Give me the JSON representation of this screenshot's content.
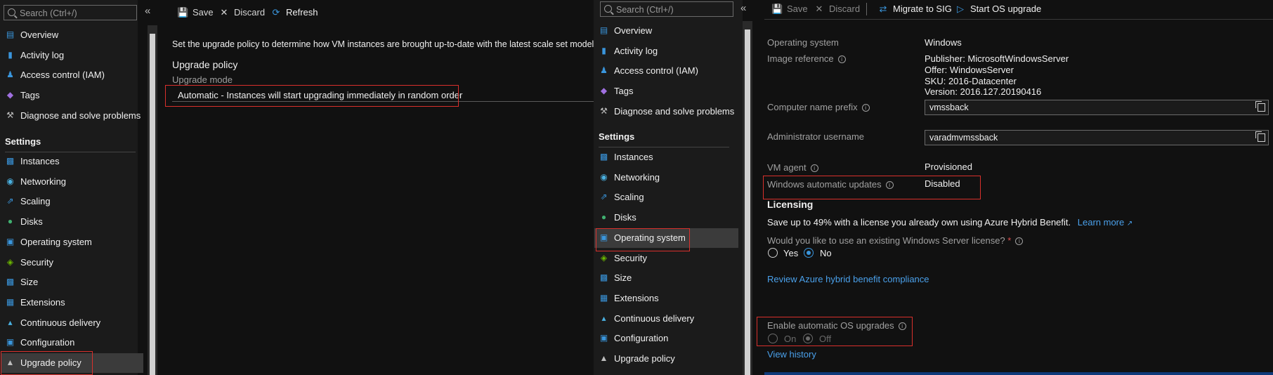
{
  "left_nav": {
    "search_placeholder": "Search (Ctrl+/)",
    "collapse_glyph": "«",
    "items_top": [
      {
        "label": "Overview",
        "icon": "overview-icon"
      },
      {
        "label": "Activity log",
        "icon": "activity-log-icon"
      },
      {
        "label": "Access control (IAM)",
        "icon": "access-control-icon"
      },
      {
        "label": "Tags",
        "icon": "tag-icon"
      },
      {
        "label": "Diagnose and solve problems",
        "icon": "wrench-icon"
      }
    ],
    "settings_header": "Settings",
    "items_settings": [
      {
        "label": "Instances",
        "icon": "instances-icon"
      },
      {
        "label": "Networking",
        "icon": "networking-icon"
      },
      {
        "label": "Scaling",
        "icon": "scaling-icon"
      },
      {
        "label": "Disks",
        "icon": "disks-icon"
      },
      {
        "label": "Operating system",
        "icon": "operating-system-icon"
      },
      {
        "label": "Security",
        "icon": "security-icon"
      },
      {
        "label": "Size",
        "icon": "size-icon"
      },
      {
        "label": "Extensions",
        "icon": "extensions-icon"
      },
      {
        "label": "Continuous delivery",
        "icon": "continuous-delivery-icon"
      },
      {
        "label": "Configuration",
        "icon": "configuration-icon"
      },
      {
        "label": "Upgrade policy",
        "icon": "upgrade-policy-icon"
      }
    ]
  },
  "upgrade_page": {
    "toolbar": {
      "save": "Save",
      "discard": "Discard",
      "refresh": "Refresh"
    },
    "description": "Set the upgrade policy to determine how VM instances are brought up-to-date with the latest scale set model.",
    "heading": "Upgrade policy",
    "mode_label": "Upgrade mode",
    "mode_value": "Automatic - Instances will start upgrading immediately in random order"
  },
  "right_nav": {
    "search_placeholder": "Search (Ctrl+/)",
    "collapse_glyph": "«",
    "items_top": [
      {
        "label": "Overview",
        "icon": "overview-icon"
      },
      {
        "label": "Activity log",
        "icon": "activity-log-icon"
      },
      {
        "label": "Access control (IAM)",
        "icon": "access-control-icon"
      },
      {
        "label": "Tags",
        "icon": "tag-icon"
      },
      {
        "label": "Diagnose and solve problems",
        "icon": "wrench-icon"
      }
    ],
    "settings_header": "Settings",
    "items_settings": [
      {
        "label": "Instances",
        "icon": "instances-icon"
      },
      {
        "label": "Networking",
        "icon": "networking-icon"
      },
      {
        "label": "Scaling",
        "icon": "scaling-icon"
      },
      {
        "label": "Disks",
        "icon": "disks-icon"
      },
      {
        "label": "Operating system",
        "icon": "operating-system-icon"
      },
      {
        "label": "Security",
        "icon": "security-icon"
      },
      {
        "label": "Size",
        "icon": "size-icon"
      },
      {
        "label": "Extensions",
        "icon": "extensions-icon"
      },
      {
        "label": "Continuous delivery",
        "icon": "continuous-delivery-icon"
      },
      {
        "label": "Configuration",
        "icon": "configuration-icon"
      },
      {
        "label": "Upgrade policy",
        "icon": "upgrade-policy-icon"
      }
    ]
  },
  "os_page": {
    "toolbar": {
      "save": "Save",
      "discard": "Discard",
      "migrate": "Migrate to SIG",
      "start_upgrade": "Start OS upgrade"
    },
    "os_label": "Operating system",
    "os_value": "Windows",
    "image_label": "Image reference",
    "image_lines": [
      "Publisher: MicrosoftWindowsServer",
      "Offer: WindowsServer",
      "SKU: 2016-Datacenter",
      "Version: 2016.127.20190416"
    ],
    "computer_prefix_label": "Computer name prefix",
    "computer_prefix_value": "vmssback",
    "admin_label": "Administrator username",
    "admin_value": "varadmvmssback",
    "vm_agent_label": "VM agent",
    "vm_agent_value": "Provisioned",
    "win_updates_label": "Windows automatic updates",
    "win_updates_value": "Disabled",
    "licensing_heading": "Licensing",
    "licensing_text": "Save up to 49% with a license you already own using Azure Hybrid Benefit.",
    "learn_more": "Learn more",
    "license_question": "Would you like to use an existing Windows Server license?",
    "required_mark": "*",
    "yes": "Yes",
    "no": "No",
    "review_link": "Review Azure hybrid benefit compliance",
    "auto_os_label": "Enable automatic OS upgrades",
    "on": "On",
    "off": "Off",
    "view_history": "View history"
  },
  "colors": {
    "accent": "#3a96dd",
    "highlight_box": "#d9302c",
    "link": "#4aa0ea"
  }
}
